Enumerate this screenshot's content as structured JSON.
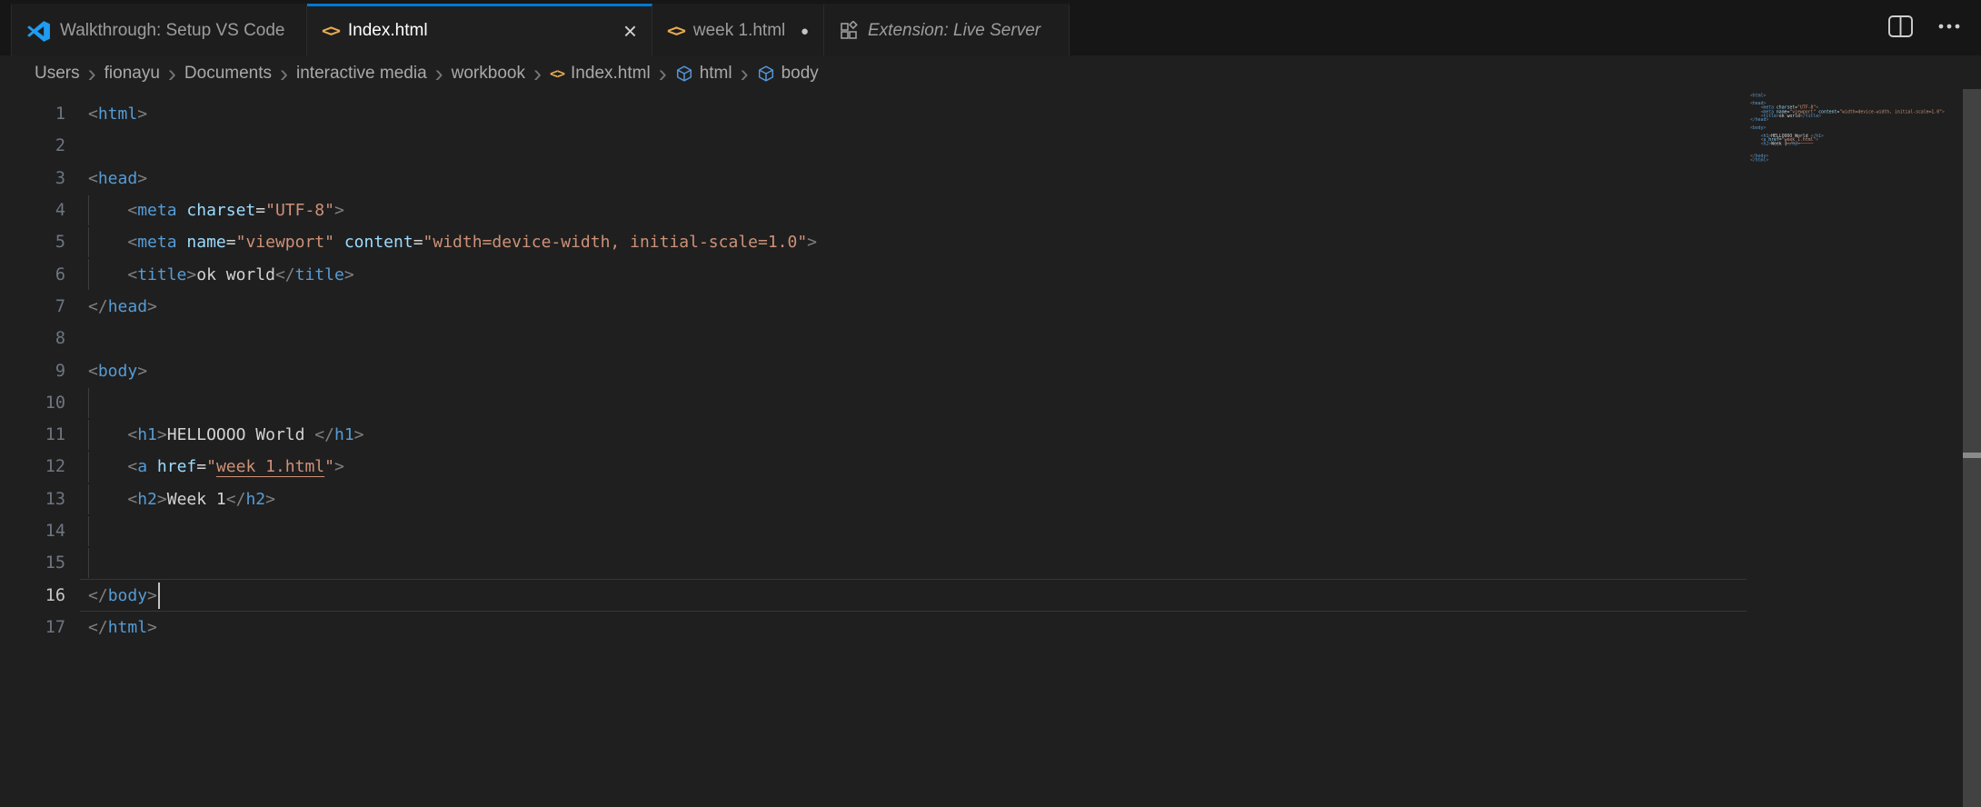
{
  "tabs": [
    {
      "label": "Walkthrough: Setup VS Code",
      "icon": "vscode-logo",
      "active": false
    },
    {
      "label": "Index.html",
      "icon": "html-file",
      "active": true,
      "close_glyph": "×"
    },
    {
      "label": "week 1.html",
      "icon": "html-file",
      "active": false,
      "modified_dot": "●"
    },
    {
      "label": "Extension: Live Server",
      "icon": "extensions",
      "active": false,
      "italic": true
    }
  ],
  "editor_actions": {
    "split_editor_icon": "split-editor",
    "more_actions_icon": "ellipsis"
  },
  "breadcrumbs": {
    "separator": "›",
    "items": [
      {
        "label": "Users"
      },
      {
        "label": "fionayu"
      },
      {
        "label": "Documents"
      },
      {
        "label": "interactive media"
      },
      {
        "label": "workbook"
      },
      {
        "label": "Index.html",
        "icon": "html-tag"
      },
      {
        "label": "html",
        "icon": "symbol-cube"
      },
      {
        "label": "body",
        "icon": "symbol-cube"
      }
    ]
  },
  "editor": {
    "language": "html",
    "cursor_line": 16,
    "lines": [
      {
        "n": 1,
        "g": false,
        "tok": [
          [
            "p",
            "<"
          ],
          [
            "t",
            "html"
          ],
          [
            "p",
            ">"
          ]
        ]
      },
      {
        "n": 2,
        "g": false,
        "tok": []
      },
      {
        "n": 3,
        "g": false,
        "tok": [
          [
            "p",
            "<"
          ],
          [
            "t",
            "head"
          ],
          [
            "p",
            ">"
          ]
        ]
      },
      {
        "n": 4,
        "g": true,
        "tok": [
          [
            "x",
            "    "
          ],
          [
            "p",
            "<"
          ],
          [
            "t",
            "meta"
          ],
          [
            "x",
            " "
          ],
          [
            "a",
            "charset"
          ],
          [
            "e",
            "="
          ],
          [
            "s",
            "\"UTF-8\""
          ],
          [
            "p",
            ">"
          ]
        ]
      },
      {
        "n": 5,
        "g": true,
        "tok": [
          [
            "x",
            "    "
          ],
          [
            "p",
            "<"
          ],
          [
            "t",
            "meta"
          ],
          [
            "x",
            " "
          ],
          [
            "a",
            "name"
          ],
          [
            "e",
            "="
          ],
          [
            "s",
            "\"viewport\""
          ],
          [
            "x",
            " "
          ],
          [
            "a",
            "content"
          ],
          [
            "e",
            "="
          ],
          [
            "s",
            "\"width=device-width, initial-scale=1.0\""
          ],
          [
            "p",
            ">"
          ]
        ]
      },
      {
        "n": 6,
        "g": true,
        "tok": [
          [
            "x",
            "    "
          ],
          [
            "p",
            "<"
          ],
          [
            "t",
            "title"
          ],
          [
            "p",
            ">"
          ],
          [
            "x",
            "ok world"
          ],
          [
            "p",
            "</"
          ],
          [
            "t",
            "title"
          ],
          [
            "p",
            ">"
          ]
        ]
      },
      {
        "n": 7,
        "g": false,
        "tok": [
          [
            "p",
            "</"
          ],
          [
            "t",
            "head"
          ],
          [
            "p",
            ">"
          ]
        ]
      },
      {
        "n": 8,
        "g": false,
        "tok": []
      },
      {
        "n": 9,
        "g": false,
        "tok": [
          [
            "p",
            "<"
          ],
          [
            "t",
            "body"
          ],
          [
            "p",
            ">"
          ]
        ]
      },
      {
        "n": 10,
        "g": true,
        "tok": []
      },
      {
        "n": 11,
        "g": true,
        "tok": [
          [
            "x",
            "    "
          ],
          [
            "p",
            "<"
          ],
          [
            "t",
            "h1"
          ],
          [
            "p",
            ">"
          ],
          [
            "x",
            "HELLOOOO World "
          ],
          [
            "p",
            "</"
          ],
          [
            "t",
            "h1"
          ],
          [
            "p",
            ">"
          ]
        ]
      },
      {
        "n": 12,
        "g": true,
        "tok": [
          [
            "x",
            "    "
          ],
          [
            "p",
            "<"
          ],
          [
            "t",
            "a"
          ],
          [
            "x",
            " "
          ],
          [
            "a",
            "href"
          ],
          [
            "e",
            "="
          ],
          [
            "s",
            "\""
          ],
          [
            "u",
            "week 1.html"
          ],
          [
            "s",
            "\""
          ],
          [
            "p",
            ">"
          ]
        ]
      },
      {
        "n": 13,
        "g": true,
        "tok": [
          [
            "x",
            "    "
          ],
          [
            "p",
            "<"
          ],
          [
            "t",
            "h2"
          ],
          [
            "p",
            ">"
          ],
          [
            "x",
            "Week 1"
          ],
          [
            "p",
            "</"
          ],
          [
            "t",
            "h2"
          ],
          [
            "p",
            ">"
          ]
        ]
      },
      {
        "n": 14,
        "g": true,
        "tok": []
      },
      {
        "n": 15,
        "g": true,
        "tok": []
      },
      {
        "n": 16,
        "g": false,
        "cur": true,
        "caret": true,
        "tok": [
          [
            "p",
            "</"
          ],
          [
            "t",
            "body"
          ],
          [
            "p",
            ">"
          ]
        ]
      },
      {
        "n": 17,
        "g": false,
        "tok": [
          [
            "p",
            "</"
          ],
          [
            "t",
            "html"
          ],
          [
            "p",
            ">"
          ]
        ]
      }
    ]
  },
  "colors": {
    "editor_background": "#1f1f1f",
    "tabbar_background": "#161616",
    "active_tab_border": "#0078d4",
    "tag": "#569cd6",
    "attribute": "#9cdcfe",
    "string": "#ce9178",
    "punctuation": "#808080",
    "text": "#d4d4d4",
    "file_icon_orange": "#e8ab53",
    "breadcrumb_symbol_blue": "#5596d8"
  }
}
